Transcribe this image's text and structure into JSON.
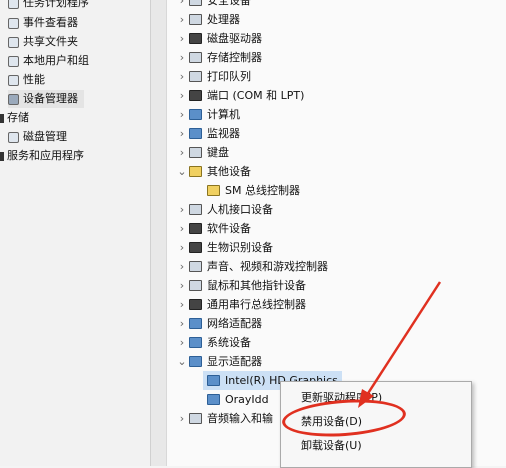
{
  "left_nav": {
    "items": [
      {
        "label": "任务计划程序"
      },
      {
        "label": "事件查看器"
      },
      {
        "label": "共享文件夹"
      },
      {
        "label": "本地用户和组"
      },
      {
        "label": "性能"
      },
      {
        "label": "设备管理器"
      },
      {
        "label": "存储"
      },
      {
        "label": "磁盘管理"
      },
      {
        "label": "服务和应用程序"
      }
    ]
  },
  "device_tree": {
    "items": [
      {
        "label": "安全设备",
        "expander": "›"
      },
      {
        "label": "处理器",
        "expander": "›"
      },
      {
        "label": "磁盘驱动器",
        "expander": "›"
      },
      {
        "label": "存储控制器",
        "expander": "›"
      },
      {
        "label": "打印队列",
        "expander": "›"
      },
      {
        "label": "端口 (COM 和 LPT)",
        "expander": "›"
      },
      {
        "label": "计算机",
        "expander": "›"
      },
      {
        "label": "监视器",
        "expander": "›"
      },
      {
        "label": "键盘",
        "expander": "›"
      },
      {
        "label": "其他设备",
        "expander": "⌄"
      },
      {
        "label": "SM 总线控制器",
        "expander": ""
      },
      {
        "label": "人机接口设备",
        "expander": "›"
      },
      {
        "label": "软件设备",
        "expander": "›"
      },
      {
        "label": "生物识别设备",
        "expander": "›"
      },
      {
        "label": "声音、视频和游戏控制器",
        "expander": "›"
      },
      {
        "label": "鼠标和其他指针设备",
        "expander": "›"
      },
      {
        "label": "通用串行总线控制器",
        "expander": "›"
      },
      {
        "label": "网络适配器",
        "expander": "›"
      },
      {
        "label": "系统设备",
        "expander": "›"
      },
      {
        "label": "显示适配器",
        "expander": "⌄"
      },
      {
        "label": "Intel(R) HD Graphics",
        "expander": ""
      },
      {
        "label": "OrayIdd",
        "expander": ""
      },
      {
        "label": "音频输入和输",
        "expander": "›"
      }
    ]
  },
  "context_menu": {
    "items": [
      {
        "label": "更新驱动程序(P)"
      },
      {
        "label": "禁用设备(D)"
      },
      {
        "label": "卸载设备(U)"
      }
    ]
  },
  "colors": {
    "annotation": "#e03020",
    "selection": "#cce0f5"
  }
}
